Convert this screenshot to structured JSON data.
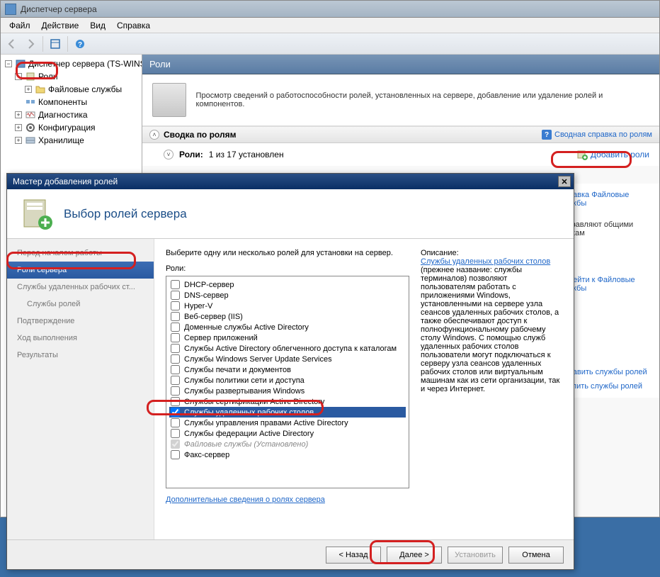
{
  "window": {
    "title": "Диспетчер сервера"
  },
  "menu": {
    "file": "Файл",
    "action": "Действие",
    "view": "Вид",
    "help": "Справка"
  },
  "tree": {
    "root": "Диспетчер сервера (TS-WINSERV",
    "roles": "Роли",
    "file_services": "Файловые службы",
    "components": "Компоненты",
    "diagnostics": "Диагностика",
    "configuration": "Конфигурация",
    "storage": "Хранилище"
  },
  "content": {
    "header": "Роли",
    "banner_text": "Просмотр сведений о работоспособности ролей, установленных на сервере, добавление или удаление ролей и компонентов.",
    "summary_title": "Сводка по ролям",
    "summary_help_link": "Сводная справка по ролям",
    "roles_count_label": "Роли:",
    "roles_count_value": "1 из 17 установлен",
    "add_roles_link": "Добавить роли"
  },
  "right_links": {
    "help_file_services": "Справка Файловые службы",
    "manage_shared_text": ", управляют общими папкам",
    "goto_file_services": "Перейти к Файловые службы",
    "add_role_services": "Добавить службы ролей",
    "remove_role_services": "Удалить службы ролей"
  },
  "wizard": {
    "title": "Мастер добавления ролей",
    "header": "Выбор ролей сервера",
    "nav": {
      "before": "Перед началом работы",
      "server_roles": "Роли сервера",
      "rds": "Службы удаленных рабочих ст...",
      "role_services": "Службы ролей",
      "confirm": "Подтверждение",
      "progress": "Ход выполнения",
      "results": "Результаты"
    },
    "instruction": "Выберите одну или несколько ролей для установки на сервер.",
    "roles_label": "Роли:",
    "roles": [
      {
        "label": "DHCP-сервер",
        "checked": false
      },
      {
        "label": "DNS-сервер",
        "checked": false
      },
      {
        "label": "Hyper-V",
        "checked": false
      },
      {
        "label": "Веб-сервер (IIS)",
        "checked": false
      },
      {
        "label": "Доменные службы Active Directory",
        "checked": false
      },
      {
        "label": "Сервер приложений",
        "checked": false
      },
      {
        "label": "Службы Active Directory облегченного доступа к каталогам",
        "checked": false
      },
      {
        "label": "Службы Windows Server Update Services",
        "checked": false
      },
      {
        "label": "Службы печати и документов",
        "checked": false
      },
      {
        "label": "Службы политики сети и доступа",
        "checked": false
      },
      {
        "label": "Службы развертывания Windows",
        "checked": false
      },
      {
        "label": "Службы сертификации Active Directory",
        "checked": false
      },
      {
        "label": "Службы удаленных рабочих столов",
        "checked": true,
        "selected": true
      },
      {
        "label": "Службы управления правами Active Directory",
        "checked": false
      },
      {
        "label": "Службы федерации Active Directory",
        "checked": false
      },
      {
        "label": "Файловые службы (Установлено)",
        "checked": true,
        "disabled": true
      },
      {
        "label": "Факс-сервер",
        "checked": false
      }
    ],
    "desc_label": "Описание:",
    "desc_link": "Службы удаленных рабочих столов",
    "desc_text": "(прежнее название: службы терминалов) позволяют пользователям работать с приложениями Windows, установленными на сервере узла сеансов удаленных рабочих столов, а также обеспечивают доступ к полнофункциональному рабочему столу Windows. С помощью служб удаленных рабочих столов пользователи могут подключаться к серверу узла сеансов удаленных рабочих столов или виртуальным машинам как из сети организации, так и через Интернет.",
    "more_info": "Дополнительные сведения о ролях сервера",
    "buttons": {
      "back": "< Назад",
      "next": "Далее >",
      "install": "Установить",
      "cancel": "Отмена"
    }
  }
}
